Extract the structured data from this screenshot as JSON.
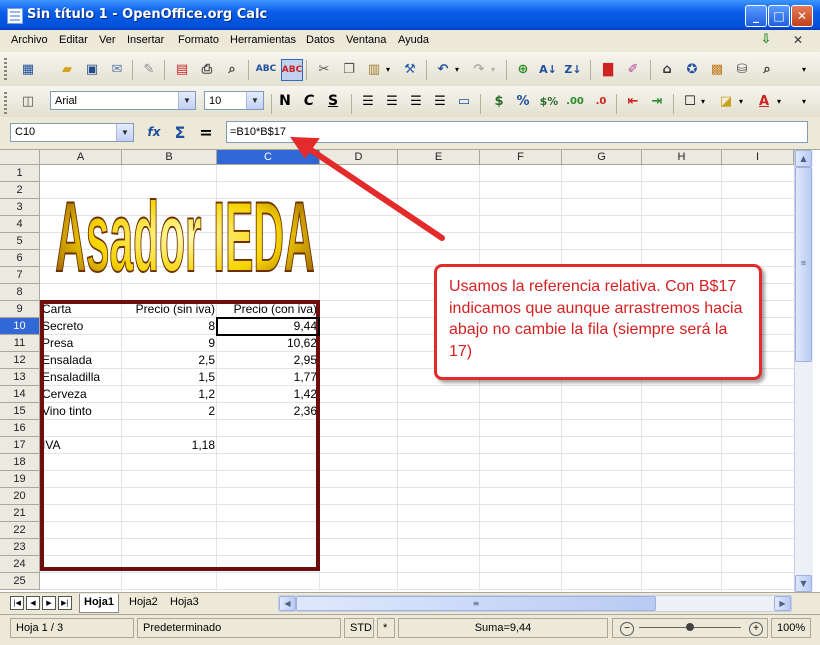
{
  "window": {
    "title": "Sin título 1 - OpenOffice.org Calc",
    "minimize": "_",
    "maximize": "□",
    "close": "✕"
  },
  "menu": [
    "Archivo",
    "Editar",
    "Ver",
    "Insertar",
    "Formato",
    "Herramientas",
    "Datos",
    "Ventana",
    "Ayuda"
  ],
  "format_toolbar": {
    "font_name": "Arial",
    "font_size": "10",
    "bold": "N",
    "italic": "C",
    "underline": "S"
  },
  "formula_bar": {
    "name_box": "C10",
    "function_icon": "fx",
    "sum_icon": "Σ",
    "equals": "=",
    "formula": "=B10*B$17"
  },
  "columns": [
    "A",
    "B",
    "C",
    "D",
    "E",
    "F",
    "G",
    "H",
    "I"
  ],
  "selected_column": "C",
  "rows": [
    "1",
    "2",
    "3",
    "4",
    "5",
    "6",
    "7",
    "8",
    "9",
    "10",
    "11",
    "12",
    "13",
    "14",
    "15",
    "16",
    "17",
    "18",
    "19",
    "20",
    "21",
    "22",
    "23",
    "24",
    "25"
  ],
  "selected_row": "10",
  "wordart": "Asador IEDA",
  "table": {
    "headers": [
      "Carta",
      "Precio (sin iva)",
      "Precio (con iva)"
    ],
    "rows": [
      {
        "item": "Secreto",
        "sin": "8",
        "con": "9,44"
      },
      {
        "item": "Presa",
        "sin": "9",
        "con": "10,62"
      },
      {
        "item": "Ensalada",
        "sin": "2,5",
        "con": "2,95"
      },
      {
        "item": "Ensaladilla",
        "sin": "1,5",
        "con": "1,77"
      },
      {
        "item": "Cerveza",
        "sin": "1,2",
        "con": "1,42"
      },
      {
        "item": "Vino tinto",
        "sin": "2",
        "con": "2,36"
      }
    ]
  },
  "iva": {
    "label": "IVA",
    "value": "1,18"
  },
  "callout": "Usamos la referencia relativa. Con B$17 indicamos que aunque arrastremos hacia abajo no cambie la fila (siempre será la 17)",
  "sheet_tabs": [
    "Hoja1",
    "Hoja2",
    "Hoja3"
  ],
  "active_tab": "Hoja1",
  "status": {
    "sheet": "Hoja 1 / 3",
    "style": "Predeterminado",
    "mode": "STD",
    "modified": "*",
    "sum": "Suma=9,44",
    "zoom": "100%"
  },
  "colors": {
    "accent": "#3168d5",
    "frame": "#6e0d0d",
    "callout": "#e42b2b"
  }
}
